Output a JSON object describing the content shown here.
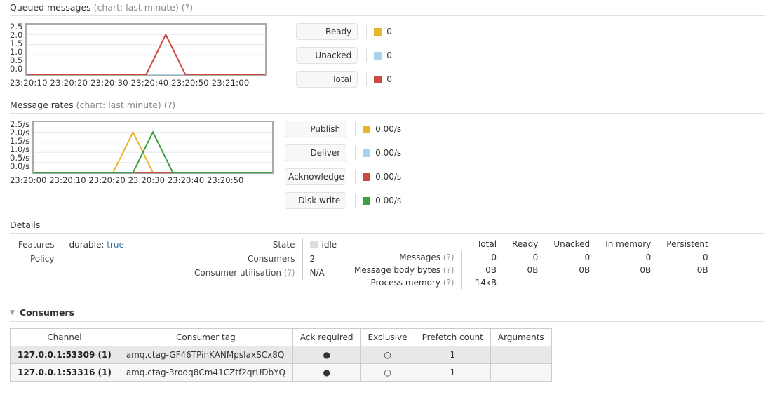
{
  "queued": {
    "title": "Queued messages",
    "subtitle": "(chart: last minute)",
    "help": "(?)",
    "legend": [
      {
        "label": "Ready",
        "value": "0",
        "color": "#e5b82e"
      },
      {
        "label": "Unacked",
        "value": "0",
        "color": "#a8d4f0"
      },
      {
        "label": "Total",
        "value": "0",
        "color": "#cc4b41"
      }
    ]
  },
  "rates": {
    "title": "Message rates",
    "subtitle": "(chart: last minute)",
    "help": "(?)",
    "legend": [
      {
        "label": "Publish",
        "value": "0.00/s",
        "color": "#e5b82e"
      },
      {
        "label": "Deliver",
        "value": "0.00/s",
        "color": "#a8d4f0"
      },
      {
        "label": "Acknowledge",
        "value": "0.00/s",
        "color": "#cc4b41"
      },
      {
        "label": "Disk write",
        "value": "0.00/s",
        "color": "#3d9e3d"
      }
    ]
  },
  "chart_data": [
    {
      "type": "line",
      "title": "Queued messages",
      "subtitle": "(chart: last minute)",
      "xlabel": "",
      "ylabel": "",
      "ylim": [
        0,
        2.5
      ],
      "yticks": [
        "2.5",
        "2.0",
        "1.5",
        "1.0",
        "0.5",
        "0.0"
      ],
      "xticks": [
        "23:20:10",
        "23:20:20",
        "23:20:30",
        "23:20:40",
        "23:20:50",
        "23:21:00"
      ],
      "x": [
        0,
        10,
        20,
        25,
        30,
        35,
        40,
        45,
        50,
        60
      ],
      "grid": true,
      "legend_position": "right",
      "series": [
        {
          "name": "Ready",
          "color": "#e5b82e",
          "values": [
            0,
            0,
            0,
            0,
            0,
            0,
            0,
            0,
            0,
            0
          ]
        },
        {
          "name": "Unacked",
          "color": "#a8d4f0",
          "values": [
            0,
            0,
            0,
            0,
            0,
            0,
            0,
            0,
            0,
            0
          ]
        },
        {
          "name": "Total",
          "color": "#cc4b41",
          "values": [
            0,
            0,
            0,
            0,
            0,
            2,
            0,
            0,
            0,
            0
          ]
        }
      ]
    },
    {
      "type": "line",
      "title": "Message rates",
      "subtitle": "(chart: last minute)",
      "xlabel": "",
      "ylabel": "",
      "ylim": [
        0,
        2.5
      ],
      "yticks": [
        "2.5/s",
        "2.0/s",
        "1.5/s",
        "1.0/s",
        "0.5/s",
        "0.0/s"
      ],
      "xticks": [
        "23:20:00",
        "23:20:10",
        "23:20:20",
        "23:20:30",
        "23:20:40",
        "23:20:50"
      ],
      "x": [
        0,
        10,
        20,
        25,
        30,
        35,
        40,
        50,
        60
      ],
      "grid": true,
      "legend_position": "right",
      "series": [
        {
          "name": "Publish",
          "color": "#e5b82e",
          "values": [
            0,
            0,
            0,
            2,
            0,
            0,
            0,
            0,
            0
          ]
        },
        {
          "name": "Deliver",
          "color": "#a8d4f0",
          "values": [
            0,
            0,
            0,
            0,
            0,
            0,
            0,
            0,
            0
          ]
        },
        {
          "name": "Acknowledge",
          "color": "#cc4b41",
          "values": [
            0,
            0,
            0,
            0,
            0,
            0,
            0,
            0,
            0
          ]
        },
        {
          "name": "Disk write",
          "color": "#3d9e3d",
          "values": [
            0,
            0,
            0,
            0,
            2,
            0,
            0,
            0,
            0
          ]
        }
      ]
    }
  ],
  "details": {
    "title": "Details",
    "features_label": "Features",
    "policy_label": "Policy",
    "features_key": "durable:",
    "features_value": "true",
    "state_label": "State",
    "state_value": "idle",
    "consumers_label": "Consumers",
    "consumers_value": "2",
    "consumer_utilisation_label": "Consumer utilisation",
    "consumer_utilisation_help": "(?)",
    "consumer_utilisation_value": "N/A",
    "stats": {
      "columns": [
        "Total",
        "Ready",
        "Unacked",
        "In memory",
        "Persistent"
      ],
      "rows": [
        {
          "label": "Messages",
          "help": "(?)",
          "values": [
            "0",
            "0",
            "0",
            "0",
            "0"
          ]
        },
        {
          "label": "Message body bytes",
          "help": "(?)",
          "values": [
            "0B",
            "0B",
            "0B",
            "0B",
            "0B"
          ]
        },
        {
          "label": "Process memory",
          "help": "(?)",
          "values": [
            "14kB",
            "",
            "",
            "",
            ""
          ]
        }
      ]
    }
  },
  "consumers": {
    "title": "Consumers",
    "toggle_icon": "triangle-down-icon",
    "columns": [
      "Channel",
      "Consumer tag",
      "Ack required",
      "Exclusive",
      "Prefetch count",
      "Arguments"
    ],
    "rows": [
      {
        "channel": "127.0.0.1:53309 (1)",
        "tag": "amq.ctag-GF46TPinKANMpsIaxSCx8Q",
        "ack_required": "●",
        "exclusive": "○",
        "prefetch_count": "1",
        "arguments": ""
      },
      {
        "channel": "127.0.0.1:53316 (1)",
        "tag": "amq.ctag-3rodq8Cm41CZtf2qrUDbYQ",
        "ack_required": "●",
        "exclusive": "○",
        "prefetch_count": "1",
        "arguments": ""
      }
    ]
  }
}
